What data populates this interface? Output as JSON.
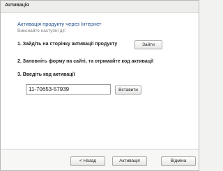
{
  "window": {
    "title": "Активація"
  },
  "main": {
    "heading": "Активація продукту через Інтернет",
    "subheading": "Виконайте наступні дії:",
    "step1_label": "1. Зайдіть на сторінку активації продукту",
    "step1_button": "Зайти",
    "step2_label": "2. Заповніть форму на сайті, та отримайте код активації",
    "step3_label": "3. Введіть код активації",
    "code_value": "11-70653-57939",
    "paste_button": "Вставити"
  },
  "footer": {
    "back_label": "< Назад",
    "activate_label": "Активація",
    "cancel_label": "Відміна"
  }
}
